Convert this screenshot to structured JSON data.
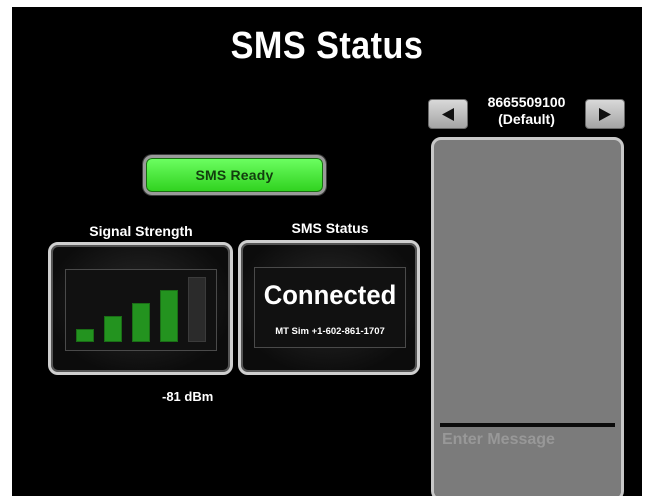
{
  "title": "SMS Status",
  "sms_ready_button": {
    "label": "SMS Ready"
  },
  "signal": {
    "label": "Signal Strength",
    "dbm": "-81 dBm",
    "bars_active": 4,
    "bars_total": 5,
    "colors": {
      "active": "#23931f",
      "inactive": "#2b2b2b"
    }
  },
  "status": {
    "label": "SMS Status",
    "value": "Connected",
    "carrier": "MT Sim +1-602-861-1707"
  },
  "recipient": {
    "number": "8665509100",
    "tag": "(Default)",
    "prev_icon": "left-triangle-icon",
    "next_icon": "right-triangle-icon"
  },
  "message": {
    "placeholder": "Enter Message",
    "value": ""
  },
  "colors": {
    "background": "#000000",
    "ready_green": "#4cf03c",
    "panel_gray": "#7b7b7b",
    "text": "#ffffff"
  }
}
